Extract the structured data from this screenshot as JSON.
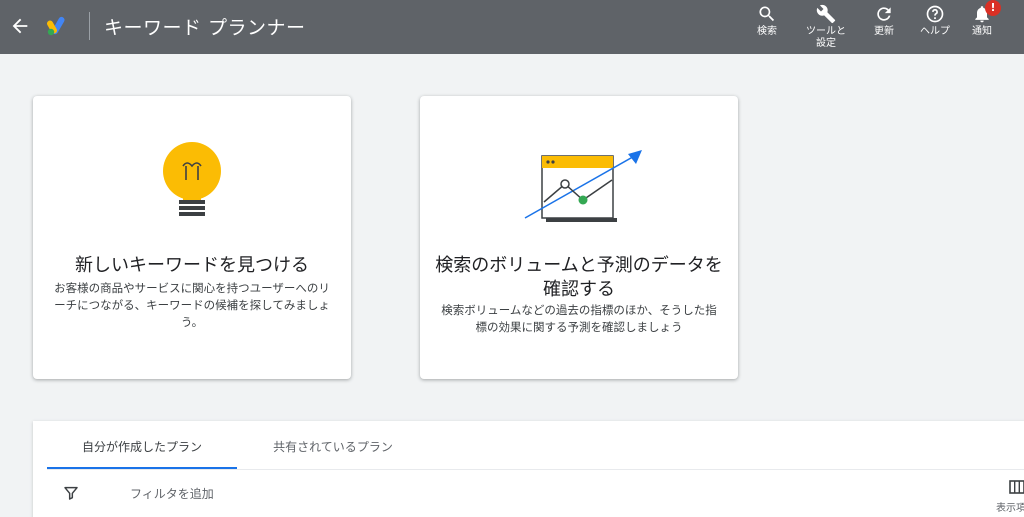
{
  "header": {
    "title": "キーワード プランナー",
    "search_label": "検索",
    "tools_label_line1": "ツールと",
    "tools_label_line2": "設定",
    "refresh_label": "更新",
    "help_label": "ヘルプ",
    "notifications_label": "通知",
    "notification_badge": "!"
  },
  "cards": [
    {
      "title": "新しいキーワードを見つける",
      "description": "お客様の商品やサービスに関心を持つユーザーへのリーチにつながる、キーワードの候補を探してみましょう。"
    },
    {
      "title": "検索のボリュームと予測のデータを確認する",
      "description": "検索ボリュームなどの過去の指標のほか、そうした指標の効果に関する予測を確認しましょう"
    }
  ],
  "plans": {
    "tabs": [
      {
        "label": "自分が作成したプラン",
        "active": true
      },
      {
        "label": "共有されているプラン",
        "active": false
      }
    ],
    "filter_label": "フィルタを追加",
    "columns_label": "表示項目"
  },
  "colors": {
    "header_bg": "#5f6368",
    "accent_blue": "#1a73e8",
    "bulb_yellow": "#fbbc04",
    "badge_red": "#d93025",
    "chart_green": "#34a853"
  },
  "icons": [
    "back-arrow-icon",
    "google-ads-logo",
    "search-icon",
    "wrench-icon",
    "refresh-icon",
    "help-icon",
    "bell-icon",
    "lightbulb-icon",
    "chart-window-icon",
    "filter-icon",
    "columns-icon"
  ]
}
